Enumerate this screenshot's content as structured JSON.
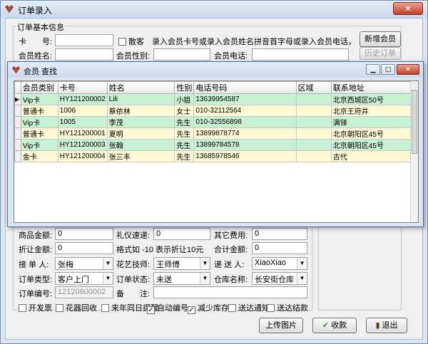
{
  "window": {
    "title": "订单录入"
  },
  "basic": {
    "group_title": "订单基本信息",
    "card_label": "卡　　号:",
    "card_value": "",
    "walkin_label": "散客",
    "hint": "录入会员卡号或录入会员姓名拼音首字母或录入会员电话，按回车...",
    "new_member": "新增会员",
    "name_label": "会员姓名:",
    "gender_label": "会员性别:",
    "phone_label": "会员电话:",
    "history_orders": "历史订单"
  },
  "popup": {
    "title": "会员 查找",
    "columns": [
      "会员类别",
      "卡号",
      "姓名",
      "性别",
      "电话号码",
      "区域",
      "联系地址"
    ],
    "rows": [
      {
        "type": "Vip卡",
        "card": "HY121200002",
        "name": "Lili",
        "gender": "小姐",
        "phone": "13639954587",
        "region": "",
        "address": "北京西城区50号"
      },
      {
        "type": "普通卡",
        "card": "1006",
        "name": "蔡依林",
        "gender": "女士",
        "phone": "010-32112564",
        "region": "",
        "address": "北京王府井"
      },
      {
        "type": "Vip卡",
        "card": "1005",
        "name": "李茂",
        "gender": "先生",
        "phone": "010-32556898",
        "region": "",
        "address": "满铎"
      },
      {
        "type": "普通卡",
        "card": "HY121200001",
        "name": "夏明",
        "gender": "先生",
        "phone": "13899878774",
        "region": "",
        "address": "北京朝阳区45号"
      },
      {
        "type": "Vip卡",
        "card": "HY121200003",
        "name": "张翰",
        "gender": "先生",
        "phone": "13899784578",
        "region": "",
        "address": "北京朝阳区45号"
      },
      {
        "type": "金卡",
        "card": "HY121200004",
        "name": "张三丰",
        "gender": "先生",
        "phone": "13685978546",
        "region": "",
        "address": "古代"
      }
    ]
  },
  "order": {
    "goods_amount_label": "商品金额:",
    "goods_amount": "0",
    "gift_fee_label": "礼仪速递:",
    "gift_fee": "0",
    "other_fee_label": "其它费用:",
    "other_fee": "0",
    "discount_label": "折让金额:",
    "discount": "0",
    "discount_hint": "格式如 -10 表示折让10元",
    "total_label": "合计金额:",
    "total": "0",
    "receiver_label": "接 单 人:",
    "receiver": "张梅",
    "florist_label": "花艺技师:",
    "florist": "王师傅",
    "courier_label": "递 送 人:",
    "courier": "XiaoXiao",
    "order_type_label": "订单类型:",
    "order_type": "客户上门",
    "order_status_label": "订单状态:",
    "order_status": "未送",
    "warehouse_label": "仓库名称:",
    "warehouse": "长安街仓库",
    "order_no_label": "订单编号:",
    "order_no": "12120800002",
    "remark_label": "备　　注:",
    "remark": ""
  },
  "options": [
    {
      "label": "开发票",
      "checked": false
    },
    {
      "label": "花器回收",
      "checked": false
    },
    {
      "label": "来年同日提醒",
      "checked": false
    },
    {
      "label": "自动编号",
      "checked": true
    },
    {
      "label": "减少库存",
      "checked": true
    },
    {
      "label": "送达通知",
      "checked": false
    },
    {
      "label": "送达结款",
      "checked": false
    }
  ],
  "buttons": {
    "upload": "上传图片",
    "collect": "收款",
    "exit": "退出"
  },
  "colors": {
    "row_green": "#c8f0d2",
    "row_yellow": "#fff8d6",
    "title_bar": "#c9d9ee"
  }
}
